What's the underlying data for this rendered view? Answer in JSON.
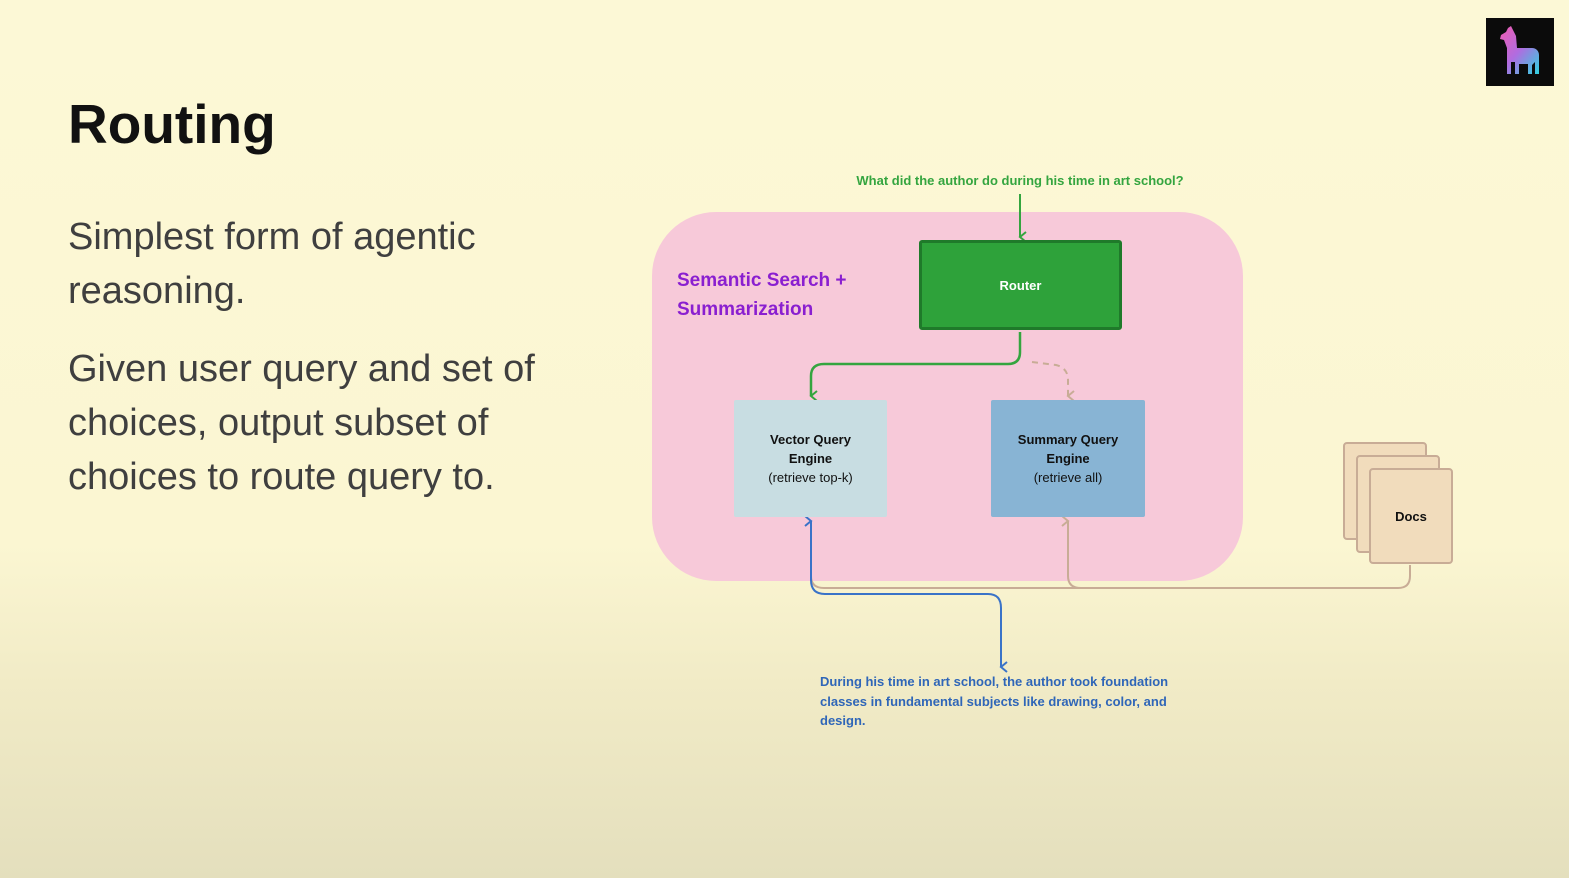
{
  "slide": {
    "title": "Routing",
    "bullets": [
      "Simplest form of agentic reasoning.",
      "Given user query and set of choices, output subset of choices to route query to."
    ]
  },
  "logo": {
    "icon": "llama-icon"
  },
  "diagram": {
    "query": "What did the author do during his time in art school?",
    "group_label": "Semantic Search + Summarization",
    "router": {
      "label": "Router"
    },
    "vector_engine": {
      "title": "Vector Query Engine",
      "subtitle": "(retrieve top-k)"
    },
    "summary_engine": {
      "title": "Summary Query Engine",
      "subtitle": "(retrieve all)"
    },
    "docs": {
      "label": "Docs"
    },
    "answer": "During his time in art school, the author took foundation classes in fundamental subjects like drawing, color, and design."
  },
  "colors": {
    "background": "#fcf8d6",
    "group_fill": "#f7c9d9",
    "router_fill": "#2ea23a",
    "vector_fill": "#c8dde2",
    "summary_fill": "#88b4d4",
    "docs_fill": "#f1dcbc",
    "query_text": "#34a53f",
    "answer_text": "#2f66b8",
    "group_label": "#8a1fd0"
  }
}
